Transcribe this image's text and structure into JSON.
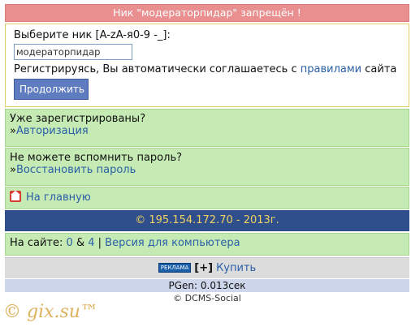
{
  "error_banner": "Ник \"модераторпидар\" запрещён !",
  "register": {
    "nick_label": "Выберите ник [A-zA-я0-9 -_]:",
    "nick_value": "модераторпидар",
    "agree_prefix": "Регистрируясь, Вы автоматически соглашаетесь с ",
    "agree_link": "правилами",
    "agree_suffix": " сайта",
    "continue_button": "Продолжить"
  },
  "already": {
    "question": "Уже зарегистрированы?",
    "bullet": "»",
    "link": "Авторизация"
  },
  "forgot": {
    "question": "Не можете вспомнить пароль?",
    "bullet": "»",
    "link": "Восстановить пароль"
  },
  "home": {
    "link": "На главную",
    "icon": "home-icon"
  },
  "copyright": "© 195.154.172.70 - 2013г.",
  "online": {
    "label": "На сайте: ",
    "count1": "0",
    "amp": " & ",
    "count2": "4",
    "sep": " | ",
    "version_link": "Версия для компьютера"
  },
  "ad": {
    "badge": "РЕКЛАМА",
    "plus": "[+]",
    "buy_link": "Купить"
  },
  "pgen": "PGen: 0.013сек",
  "footer": "© DCMS-Social",
  "watermark": "© gix.su™",
  "colors": {
    "error_bg": "#e98f8f",
    "green_bg": "#c6eab4",
    "blue_bg": "#2f4f8c",
    "copyright_text": "#f0d060",
    "link": "#2a5fa8"
  }
}
